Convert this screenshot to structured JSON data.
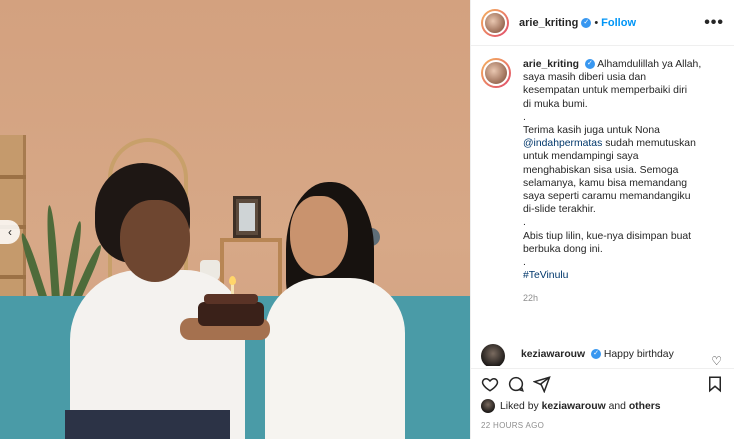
{
  "post": {
    "author": "arie_kriting",
    "separator": "•",
    "follow_label": "Follow",
    "more_label": "•••",
    "carousel_prev": "‹"
  },
  "caption": {
    "username": "arie_kriting",
    "lines": [
      "Alhamdulillah ya Allah,",
      "saya masih diberi usia dan",
      "kesempatan untuk memperbaiki diri",
      "di muka bumi.",
      ".",
      "Terima kasih juga untuk Nona",
      "@indahpermatas",
      "sudah memutuskan",
      "untuk mendampingi saya",
      "menghabiskan sisa usia. Semoga",
      "selamanya, kamu bisa memandang",
      "saya seperti caramu memandangiku",
      "di-slide terakhir.",
      ".",
      "Abis tiup lilin, kue-nya disimpan buat",
      "berbuka dong ini.",
      ".",
      "#TeVinulu"
    ],
    "time": "22h"
  },
  "comment": {
    "username": "keziawarouw",
    "text": "Happy birthday"
  },
  "likes": {
    "prefix": "Liked by",
    "user": "keziawarouw",
    "and": "and",
    "others": "others"
  },
  "posted": "22 HOURS AGO",
  "icons": [
    "heart-icon",
    "comment-icon",
    "share-icon",
    "bookmark-icon",
    "verified-icon",
    "more-icon"
  ],
  "colors": {
    "link": "#0095f6",
    "mention": "#00376b",
    "verified": "#3897f0",
    "muted": "#8e8e8e"
  }
}
